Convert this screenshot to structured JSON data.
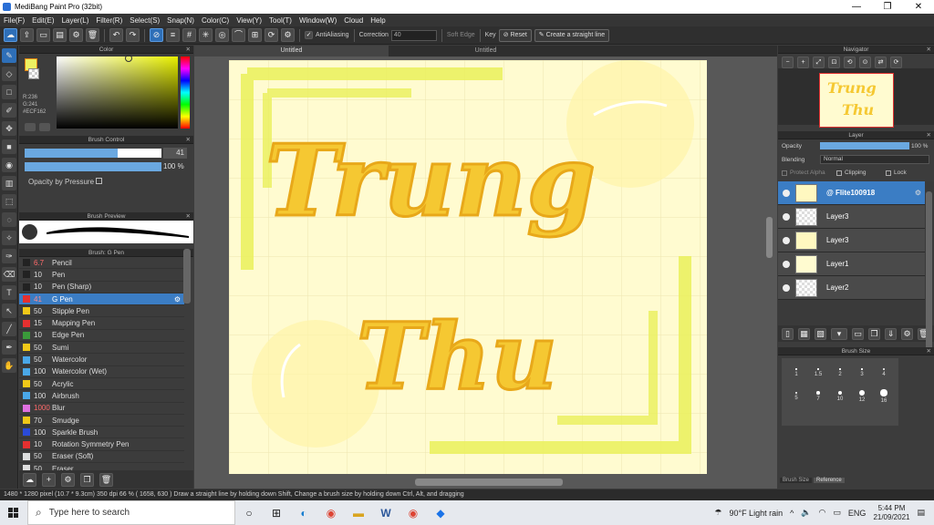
{
  "window": {
    "title": "MediBang Paint Pro (32bit)",
    "controls": [
      "—",
      "❐",
      "✕"
    ]
  },
  "menu": [
    "File(F)",
    "Edit(E)",
    "Layer(L)",
    "Filter(R)",
    "Select(S)",
    "Snap(N)",
    "Color(C)",
    "View(Y)",
    "Tool(T)",
    "Window(W)",
    "Cloud",
    "Help"
  ],
  "toolbar": {
    "antialiasing": "AntiAliasing",
    "correction_label": "Correction",
    "correction_value": "40",
    "soft_edge": "Soft Edge",
    "key_label": "Key",
    "reset_label": "Reset",
    "straight_line": "Create a straight line"
  },
  "color_panel": {
    "title": "Color",
    "r": "R:236",
    "g": "G:241",
    "hex": "#ECF162"
  },
  "brush_control": {
    "title": "Brush Control",
    "size": "41",
    "opacity": "100 %",
    "opacity_pressure": "Opacity by Pressure"
  },
  "brush_preview": {
    "title": "Brush Preview"
  },
  "brush_list": {
    "title": "Brush: G Pen",
    "items": [
      {
        "num": "6.7",
        "name": "Pencil",
        "color": "#222222",
        "numcolor": "#ff6a6a"
      },
      {
        "num": "10",
        "name": "Pen",
        "color": "#222222",
        "numcolor": "#dddddd"
      },
      {
        "num": "10",
        "name": "Pen (Sharp)",
        "color": "#222222",
        "numcolor": "#dddddd"
      },
      {
        "num": "41",
        "name": "G Pen",
        "color": "#e53030",
        "numcolor": "#ff6a6a"
      },
      {
        "num": "50",
        "name": "Stipple Pen",
        "color": "#f0c818",
        "numcolor": "#dddddd"
      },
      {
        "num": "15",
        "name": "Mapping Pen",
        "color": "#e53030",
        "numcolor": "#dddddd"
      },
      {
        "num": "10",
        "name": "Edge Pen",
        "color": "#3a9a3a",
        "numcolor": "#dddddd"
      },
      {
        "num": "50",
        "name": "Sumi",
        "color": "#f0c818",
        "numcolor": "#dddddd"
      },
      {
        "num": "50",
        "name": "Watercolor",
        "color": "#4aa8e8",
        "numcolor": "#dddddd"
      },
      {
        "num": "100",
        "name": "Watercolor (Wet)",
        "color": "#4aa8e8",
        "numcolor": "#dddddd"
      },
      {
        "num": "50",
        "name": "Acrylic",
        "color": "#f0c818",
        "numcolor": "#dddddd"
      },
      {
        "num": "100",
        "name": "Airbrush",
        "color": "#4aa8e8",
        "numcolor": "#dddddd"
      },
      {
        "num": "1000",
        "name": "Blur",
        "color": "#e070e0",
        "numcolor": "#ff6a6a"
      },
      {
        "num": "70",
        "name": "Smudge",
        "color": "#f0c818",
        "numcolor": "#dddddd"
      },
      {
        "num": "100",
        "name": "Sparkle Brush",
        "color": "#2a4ad8",
        "numcolor": "#dddddd"
      },
      {
        "num": "10",
        "name": "Rotation Symmetry Pen",
        "color": "#e53030",
        "numcolor": "#dddddd"
      },
      {
        "num": "50",
        "name": "Eraser (Soft)",
        "color": "#dddddd",
        "numcolor": "#dddddd"
      },
      {
        "num": "50",
        "name": "Eraser",
        "color": "#dddddd",
        "numcolor": "#dddddd"
      }
    ]
  },
  "tabs": [
    "Untitled",
    "Untitled"
  ],
  "canvas_text": {
    "line1": "Trung",
    "line2": "Thu"
  },
  "navigator": {
    "title": "Navigator"
  },
  "layer_panel": {
    "title": "Layer",
    "opacity_label": "Opacity",
    "opacity_value": "100 %",
    "blending_label": "Blending",
    "blending_value": "Normal",
    "protect_alpha": "Protect Alpha",
    "clipping": "Clipping",
    "lock": "Lock",
    "layers": [
      "@ Flite100918",
      "Layer3",
      "Layer3",
      "Layer1",
      "Layer2"
    ]
  },
  "brush_size_panel": {
    "title": "Brush Size",
    "sizes": [
      "1",
      "1.5",
      "2",
      "3",
      "4",
      "5",
      "7",
      "10",
      "12",
      "16"
    ],
    "tabs": [
      "Brush Size",
      "Reference"
    ]
  },
  "status_bar": "1480 * 1280 pixel   (10.7 * 9.3cm)   350 dpi   66 %   ( 1658, 630 )   Draw a straight line by holding down Shift, Change a brush size by holding down Ctrl, Alt, and dragging",
  "taskbar": {
    "search_placeholder": "Type here to search",
    "weather": "90°F  Light rain",
    "lang": "ENG",
    "time": "5:44 PM",
    "date": "21/09/2021"
  }
}
